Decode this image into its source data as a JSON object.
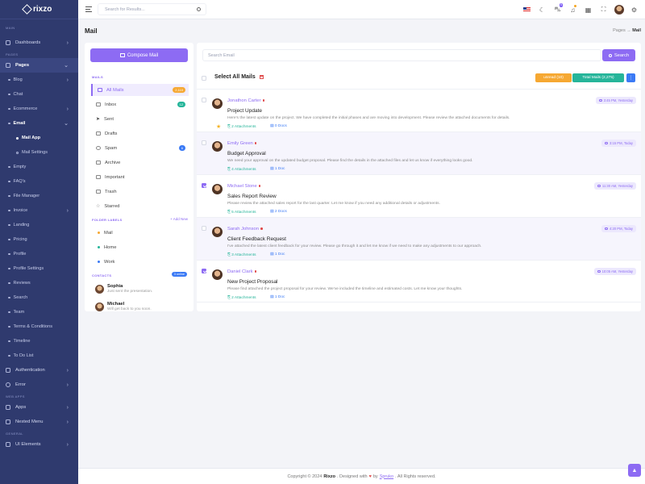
{
  "brand": "rixzo",
  "sidebar": {
    "sec_main": "MAIN",
    "dashboards": "Dashboards",
    "sec_pages": "PAGES",
    "pages": "Pages",
    "blog": "Blog",
    "chat": "Chat",
    "ecommerce": "Ecommerce",
    "email": "Email",
    "mail_app": "Mail App",
    "mail_settings": "Mail Settings",
    "empty": "Empty",
    "faqs": "FAQ's",
    "file_manager": "File Manager",
    "invoice": "Invoice",
    "landing": "Landing",
    "pricing": "Pricing",
    "profile": "Profile",
    "profile_settings": "Profile Settings",
    "reviews": "Reviews",
    "search": "Search",
    "team": "Team",
    "terms": "Terms & Conditions",
    "timeline": "Timeline",
    "todo": "To Do List",
    "authentication": "Authentication",
    "error": "Error",
    "sec_web_apps": "WEB APPS",
    "apps": "Apps",
    "nested_menu": "Nested Menu",
    "sec_general": "GENERAL",
    "ui_elements": "UI Elements"
  },
  "topbar": {
    "search_placeholder": "Search for Results...",
    "cart_count": "5"
  },
  "header": {
    "title": "Mail",
    "crumb_parent": "Pages",
    "crumb_sep": "→",
    "crumb_current": "Mail"
  },
  "left": {
    "compose": "Compose Mail",
    "sec_mails": "MAILS",
    "all_mails": "All Mails",
    "all_count": "2,110",
    "inbox": "Inbox",
    "inbox_count": "12",
    "sent": "Sent",
    "drafts": "Drafts",
    "spam": "Spam",
    "spam_count": "6",
    "archive": "Archive",
    "important": "Important",
    "trash": "Trash",
    "starred": "Starred",
    "sec_labels": "FOLDER LABELS",
    "add_new": "+ Add New",
    "lbl_mail": "Mail",
    "lbl_home": "Home",
    "lbl_work": "Work",
    "sec_contacts": "CONTACTS",
    "online": "3 online",
    "c1_name": "Sophia",
    "c1_msg": "Just sent the presentation.",
    "c2_name": "Michael",
    "c2_msg": "Will get back to you soon."
  },
  "main": {
    "search_placeholder": "Search Email",
    "search_btn": "Search",
    "select_all": "Select All Mails",
    "unread": "unread (10)",
    "total": "Total Mails (2,275)",
    "more": "⋮"
  },
  "mails": [
    {
      "from": "Jonathon Carter",
      "time": "3:45 PM, Yesterday",
      "subject": "Project Update",
      "body": "Here's the latest update on the project. We have completed the initial phases and are moving into development. Please review the attached documents for details.",
      "att": "2 Attachments",
      "docs": "0 Docs"
    },
    {
      "from": "Emily Green",
      "time": "3:15 PM, Today",
      "subject": "Budget Approval",
      "body": "We need your approval on the updated budget proposal. Please find the details in the attached files and let us know if everything looks good.",
      "att": "4 Attachments",
      "docs": "1 Doc"
    },
    {
      "from": "Michael Stone",
      "time": "11:30 AM, Yesterday",
      "subject": "Sales Report Review",
      "body": "Please review the attached sales report for the last quarter. Let me know if you need any additional details or adjustments.",
      "att": "5 Attachments",
      "docs": "2 Docs"
    },
    {
      "from": "Sarah Johnson",
      "time": "4:20 PM, Today",
      "subject": "Client Feedback Request",
      "body": "I've attached the latest client feedback for your review. Please go through it and let me know if we need to make any adjustments to our approach.",
      "att": "3 Attachments",
      "docs": "1 Doc"
    },
    {
      "from": "Daniel Clark",
      "time": "10:05 AM, Yesterday",
      "subject": "New Project Proposal",
      "body": "Please find attached the project proposal for your review. We've included the timeline and estimated costs. Let me know your thoughts.",
      "att": "2 Attachments",
      "docs": "1 Doc"
    }
  ],
  "footer": {
    "pre": "Copyright © 2024",
    "brand": "Rixzo",
    "mid": ". Designed with",
    "heart": "♥",
    "by": "by",
    "company": "Spruko",
    "post": ". All Rights reserved."
  }
}
